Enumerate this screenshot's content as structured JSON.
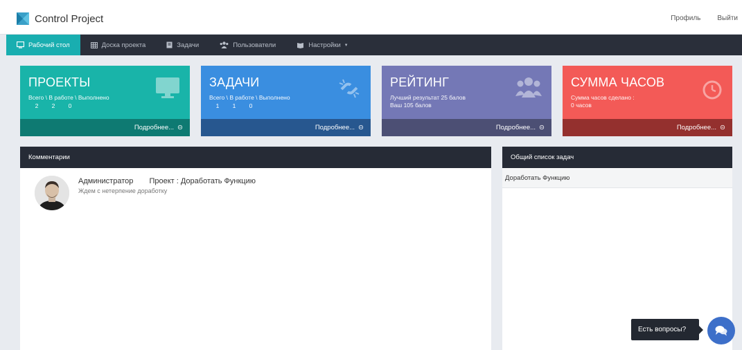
{
  "app": {
    "title": "Control Project",
    "links": {
      "profile": "Профиль",
      "logout": "Выйти"
    }
  },
  "nav": {
    "items": [
      {
        "label": "Рабочий стол",
        "icon": "monitor-icon",
        "active": true
      },
      {
        "label": "Доска проекта",
        "icon": "table-icon",
        "active": false
      },
      {
        "label": "Задачи",
        "icon": "book-icon",
        "active": false
      },
      {
        "label": "Пользователи",
        "icon": "users-icon",
        "active": false
      },
      {
        "label": "Настройки",
        "icon": "book-open-icon",
        "active": false,
        "dropdown": true
      }
    ]
  },
  "stats": [
    {
      "title": "ПРОЕКТЫ",
      "sub": "Всего \\ В работе \\ Выполнено",
      "values": [
        "2",
        "2",
        "0"
      ],
      "more": "Подробнее...",
      "icon": "monitor-icon",
      "color": "#19b4a9"
    },
    {
      "title": "ЗАДАЧИ",
      "sub": "Всего \\ В работе \\ Выполнено",
      "values": [
        "1",
        "1",
        "0"
      ],
      "more": "Подробнее...",
      "icon": "broken-link-icon",
      "color": "#3a8ee0"
    },
    {
      "title": "РЕЙТИНГ",
      "line1": "Лучший результат 25 балов",
      "line2": "Ваш 105 балов",
      "more": "Подробнее...",
      "icon": "users-icon",
      "color": "#7478b6"
    },
    {
      "title": "СУММА ЧАСОВ",
      "line1": "Сумма часов сделано :",
      "line2": "0 часов",
      "more": "Подробнее...",
      "icon": "clock-icon",
      "color": "#f35a57"
    }
  ],
  "comments": {
    "title": "Комментарии",
    "items": [
      {
        "author": "Администратор",
        "project": "Проект : Доработать Функцию",
        "text": "Ждем с нетерпение доработку"
      }
    ]
  },
  "tasks": {
    "title": "Общий список задач",
    "items": [
      "Доработать Функцию"
    ]
  },
  "help": {
    "label": "Есть вопросы?"
  }
}
